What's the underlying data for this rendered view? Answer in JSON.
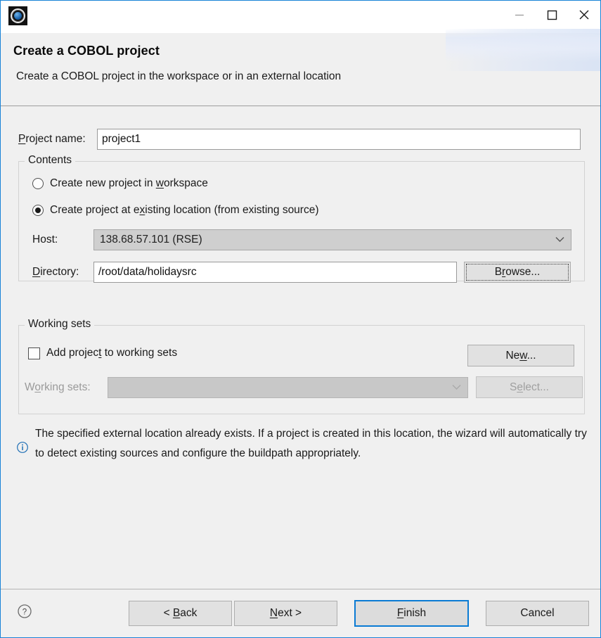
{
  "window": {
    "icon_name": "cobol-app-icon",
    "minimize_label": "Minimize",
    "maximize_label": "Maximize",
    "close_label": "Close"
  },
  "header": {
    "title": "Create a COBOL project",
    "description": "Create a COBOL project in the workspace or in an external location"
  },
  "form": {
    "project_name_label_pre": "",
    "project_name_label_mnemonic": "P",
    "project_name_label_post": "roject name:",
    "project_name_value": "project1"
  },
  "contents": {
    "group_title": "Contents",
    "radio_workspace": {
      "pre": "Create new project in ",
      "mnemonic": "w",
      "post": "orkspace",
      "selected": false
    },
    "radio_existing": {
      "pre": "Create project at e",
      "mnemonic": "x",
      "post": "isting location (from existing source)",
      "selected": true
    },
    "host_label": "Host:",
    "host_value": "138.68.57.101 (RSE)",
    "directory_label_mnemonic": "D",
    "directory_label_post": "irectory:",
    "directory_value": "/root/data/holidaysrc",
    "browse_pre": "B",
    "browse_mnemonic": "r",
    "browse_post": "owse..."
  },
  "working_sets": {
    "group_title": "Working sets",
    "checkbox_pre": "Add projec",
    "checkbox_mnemonic": "t",
    "checkbox_post": " to working sets",
    "checkbox_checked": false,
    "new_pre": "Ne",
    "new_mnemonic": "w",
    "new_post": "...",
    "list_label_pre": "W",
    "list_label_mnemonic": "o",
    "list_label_post": "rking sets:",
    "list_value": "",
    "select_pre": "S",
    "select_mnemonic": "e",
    "select_post": "lect..."
  },
  "info": {
    "icon_name": "info-circle-icon",
    "text": "The specified external location already exists. If a project is created in this location, the wizard will automatically try to detect existing sources and configure the buildpath appropriately."
  },
  "footer": {
    "help_icon_name": "help-circle-icon",
    "back_pre": "< ",
    "back_mnemonic": "B",
    "back_post": "ack",
    "next_pre": "",
    "next_mnemonic": "N",
    "next_post": "ext >",
    "finish_pre": "",
    "finish_mnemonic": "F",
    "finish_post": "inish",
    "cancel_label": "Cancel"
  },
  "colors": {
    "accent": "#0a7bd4",
    "window_border": "#1883d7",
    "body_bg": "#f0f0f0",
    "info_icon": "#1f6fb5"
  }
}
